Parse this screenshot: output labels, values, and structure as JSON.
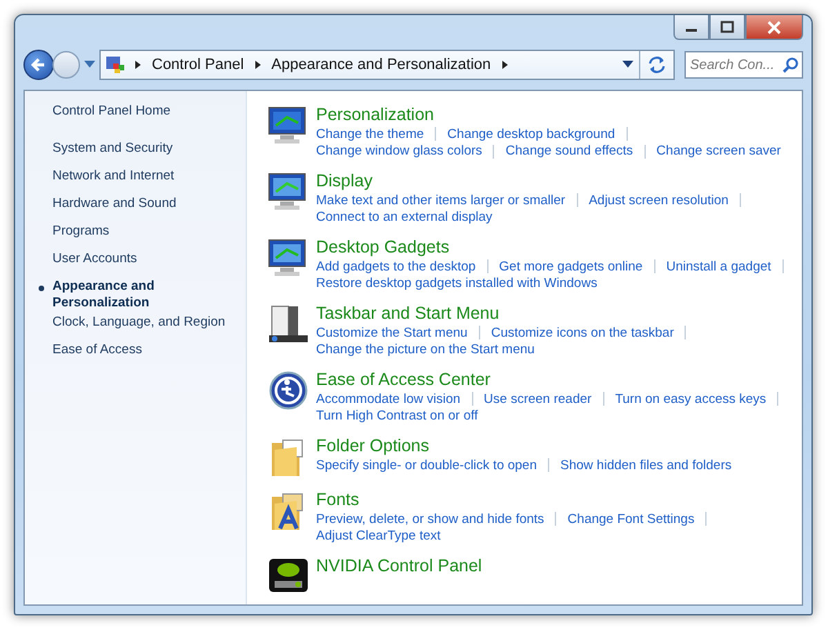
{
  "address_bar": {
    "breadcrumbs": [
      "Control Panel",
      "Appearance and Personalization"
    ]
  },
  "search": {
    "placeholder": "Search Con..."
  },
  "sidebar": {
    "home": "Control Panel Home",
    "items": [
      {
        "label": "System and Security",
        "selected": false
      },
      {
        "label": "Network and Internet",
        "selected": false
      },
      {
        "label": "Hardware and Sound",
        "selected": false
      },
      {
        "label": "Programs",
        "selected": false
      },
      {
        "label": "User Accounts",
        "selected": false
      },
      {
        "label": "Appearance and Personalization",
        "selected": true
      },
      {
        "label": "Clock, Language, and Region",
        "selected": false
      },
      {
        "label": "Ease of Access",
        "selected": false
      }
    ]
  },
  "categories": [
    {
      "title": "Personalization",
      "link_lines": [
        [
          "Change the theme",
          "Change desktop background"
        ],
        [
          "Change window glass colors",
          "Change sound effects",
          "Change screen saver"
        ]
      ]
    },
    {
      "title": "Display",
      "link_lines": [
        [
          "Make text and other items larger or smaller",
          "Adjust screen resolution"
        ],
        [
          "Connect to an external display"
        ]
      ]
    },
    {
      "title": "Desktop Gadgets",
      "link_lines": [
        [
          "Add gadgets to the desktop",
          "Get more gadgets online",
          "Uninstall a gadget"
        ],
        [
          "Restore desktop gadgets installed with Windows"
        ]
      ]
    },
    {
      "title": "Taskbar and Start Menu",
      "link_lines": [
        [
          "Customize the Start menu",
          "Customize icons on the taskbar"
        ],
        [
          "Change the picture on the Start menu"
        ]
      ]
    },
    {
      "title": "Ease of Access Center",
      "link_lines": [
        [
          "Accommodate low vision",
          "Use screen reader",
          "Turn on easy access keys"
        ],
        [
          "Turn High Contrast on or off"
        ]
      ]
    },
    {
      "title": "Folder Options",
      "link_lines": [
        [
          "Specify single- or double-click to open",
          "Show hidden files and folders"
        ]
      ]
    },
    {
      "title": "Fonts",
      "link_lines": [
        [
          "Preview, delete, or show and hide fonts",
          "Change Font Settings"
        ],
        [
          "Adjust ClearType text"
        ]
      ]
    },
    {
      "title": "NVIDIA Control Panel"
    }
  ]
}
